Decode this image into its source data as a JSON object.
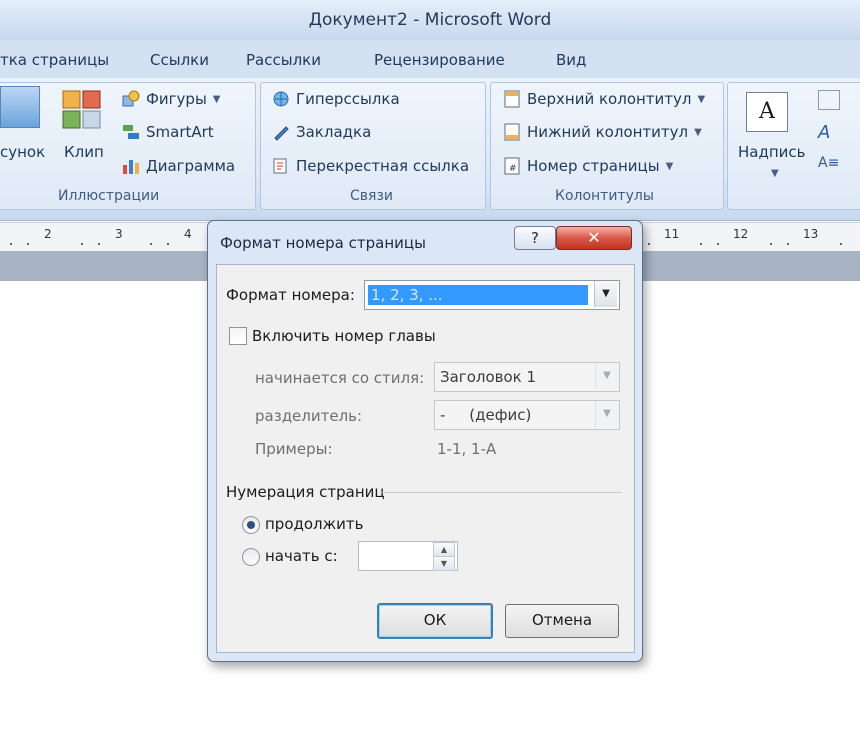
{
  "window": {
    "title": "Документ2 - Microsoft Word"
  },
  "ribbon_tabs": [
    {
      "label": "тка страницы"
    },
    {
      "label": "Ссылки"
    },
    {
      "label": "Рассылки"
    },
    {
      "label": "Рецензирование"
    },
    {
      "label": "Вид"
    }
  ],
  "ribbon": {
    "illustrations": {
      "picture_label": "сунок",
      "clip_label": "Клип",
      "shapes_label": "Фигуры",
      "smartart_label": "SmartArt",
      "chart_label": "Диаграмма",
      "group_label": "Иллюстрации"
    },
    "links": {
      "hyperlink_label": "Гиперссылка",
      "bookmark_label": "Закладка",
      "crossref_label": "Перекрестная ссылка",
      "group_label": "Связи"
    },
    "header_footer": {
      "header_label": "Верхний колонтитул",
      "footer_label": "Нижний колонтитул",
      "page_number_label": "Номер страницы",
      "group_label": "Колонтитулы"
    },
    "text": {
      "textbox_label": "Надпись",
      "textbox_icon_letter": "A"
    }
  },
  "ruler": {
    "left_numbers": [
      "2",
      "3",
      "4"
    ],
    "right_numbers": [
      "11",
      "12",
      "13"
    ]
  },
  "dialog": {
    "title": "Формат номера страницы",
    "help_label": "?",
    "close_label": "✕",
    "number_format_label": "Формат номера:",
    "number_format_value": "1, 2, 3, ...",
    "include_chapter_label": "Включить номер главы",
    "starts_with_style_label": "начинается со стиля:",
    "starts_with_style_value": "Заголовок 1",
    "separator_label": "разделитель:",
    "separator_value": "-     (дефис)",
    "examples_label": "Примеры:",
    "examples_value": "1-1, 1-А",
    "page_numbering_label": "Нумерация страниц",
    "continue_label": "продолжить",
    "start_at_label": "начать с:",
    "start_at_value": "",
    "ok_label": "ОК",
    "cancel_label": "Отмена"
  },
  "colors": {
    "ribbon_bg": "#dbe7f6",
    "selection": "#3399ff",
    "close_button": "#c9402f"
  }
}
